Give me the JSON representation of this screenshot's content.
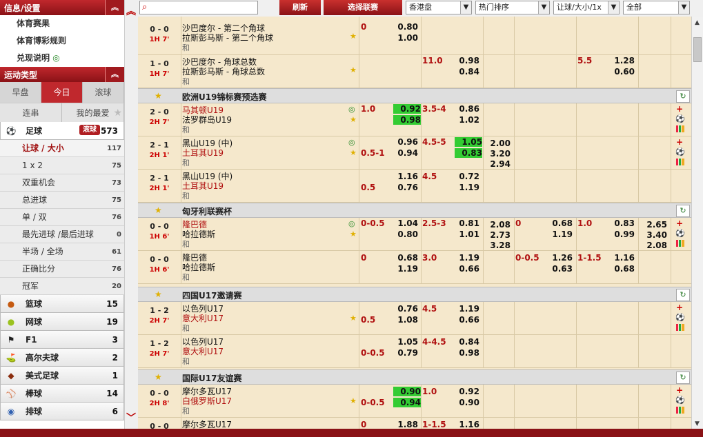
{
  "sidebar": {
    "info_title": "信息/设置",
    "info_items": [
      "体育赛果",
      "体育博彩规则",
      "兑现说明"
    ],
    "sport_type_title": "运动类型",
    "tabs": [
      "早盘",
      "今日",
      "滚球"
    ],
    "sub_tabs": [
      "连串",
      "我的最爱"
    ],
    "football": {
      "label": "足球",
      "badge": "滚球",
      "count": "573"
    },
    "bet_types": [
      {
        "label": "让球 / 大小",
        "count": "117"
      },
      {
        "label": "1 x 2",
        "count": "75"
      },
      {
        "label": "双重机会",
        "count": "73"
      },
      {
        "label": "总进球",
        "count": "75"
      },
      {
        "label": "单 / 双",
        "count": "76"
      },
      {
        "label": "最先进球 /最后进球",
        "count": "0"
      },
      {
        "label": "半场 / 全场",
        "count": "61"
      },
      {
        "label": "正确比分",
        "count": "76"
      },
      {
        "label": "冠军",
        "count": "20"
      }
    ],
    "sports": [
      {
        "label": "篮球",
        "count": "15"
      },
      {
        "label": "网球",
        "count": "19"
      },
      {
        "label": "F1",
        "count": "3"
      },
      {
        "label": "高尔夫球",
        "count": "2"
      },
      {
        "label": "美式足球",
        "count": "1"
      },
      {
        "label": "棒球",
        "count": "14"
      },
      {
        "label": "排球",
        "count": "6"
      }
    ]
  },
  "toolbar": {
    "refresh": "刷新",
    "select_league": "选择联赛",
    "odds_type": "香港盘",
    "sort": "热门排序",
    "market": "让球/大小/1x",
    "filter": "全部"
  },
  "leagues": [
    "欧洲U19锦标赛预选赛",
    "匈牙利联赛杯",
    "四国U17邀请赛",
    "国际U17友谊赛"
  ],
  "matches": [
    {
      "score": "0 - 0",
      "time": "1H 7'",
      "home": "沙巴度尔 - 第二个角球",
      "away": "拉斯彭马斯 - 第二个角球",
      "draw": "和",
      "o1": "0",
      "o2": "0.80",
      "o3": "1.00"
    },
    {
      "score": "1 - 0",
      "time": "1H 7'",
      "home": "沙巴度尔 - 角球总数",
      "away": "拉斯彭马斯 - 角球总数",
      "draw": "和",
      "hd1": "11.0",
      "v1": "0.98",
      "v2": "0.84",
      "hd2": "5.5",
      "v3": "1.28",
      "v4": "0.60"
    },
    {
      "score": "2 - 0",
      "time": "2H 7'",
      "home": "马其顿U19",
      "away": "法罗群岛U19",
      "draw": "和",
      "h": "1.0",
      "a": "0.92",
      "b": "0.98",
      "c": "3.5-4",
      "d": "0.86",
      "e": "1.02"
    },
    {
      "score": "2 - 1",
      "time": "2H 1'",
      "home": "黑山U19 (中)",
      "away": "土耳其U19",
      "draw": "和",
      "h": "0.5-1",
      "a": "0.96",
      "b": "0.94",
      "c": "4.5-5",
      "d": "1.05",
      "e": "0.83",
      "x1": "2.00",
      "x2": "3.20",
      "x3": "2.94"
    },
    {
      "score": "2 - 1",
      "time": "2H 1'",
      "home": "黑山U19 (中)",
      "away": "土耳其U19",
      "draw": "和",
      "h": "0.5",
      "a": "1.16",
      "b": "0.76",
      "c": "4.5",
      "d": "0.72",
      "e": "1.19"
    },
    {
      "score": "0 - 0",
      "time": "1H 6'",
      "home": "隆巴德",
      "away": "哈拉德斯",
      "draw": "和",
      "h": "0-0.5",
      "a": "1.04",
      "b": "0.80",
      "c": "2.5-3",
      "d": "0.81",
      "e": "1.01",
      "x1": "2.08",
      "x2": "2.73",
      "x3": "3.28",
      "h2": "0",
      "f": "0.68",
      "g": "1.19",
      "h3": "1.0",
      "i": "0.83",
      "j": "0.99",
      "y1": "2.65",
      "y2": "3.40",
      "y3": "2.08"
    },
    {
      "score": "0 - 0",
      "time": "1H 6'",
      "home": "隆巴德",
      "away": "哈拉德斯",
      "draw": "和",
      "h": "0",
      "a": "0.68",
      "b": "1.19",
      "c": "3.0",
      "d": "1.19",
      "e": "0.66",
      "h2": "0-0.5",
      "f": "1.26",
      "g": "0.63",
      "h3": "1-1.5",
      "i": "1.16",
      "j": "0.68"
    },
    {
      "score": "1 - 2",
      "time": "2H 7'",
      "home": "以色列U17",
      "away": "意大利U17",
      "draw": "和",
      "h": "0.5",
      "a": "0.76",
      "b": "1.08",
      "c": "4.5",
      "d": "1.19",
      "e": "0.66"
    },
    {
      "score": "1 - 2",
      "time": "2H 7'",
      "home": "以色列U17",
      "away": "意大利U17",
      "draw": "和",
      "h": "0-0.5",
      "a": "1.05",
      "b": "0.79",
      "c": "4-4.5",
      "d": "0.84",
      "e": "0.98"
    },
    {
      "score": "0 - 0",
      "time": "2H 8'",
      "home": "摩尔多瓦U17",
      "away": "白俄罗斯U17",
      "draw": "和",
      "h": "0-0.5",
      "a": "0.90",
      "b": "0.94",
      "c": "1.0",
      "d": "0.92",
      "e": "0.90"
    },
    {
      "score": "0 - 0",
      "time": "",
      "home": "摩尔多瓦U17",
      "away": "",
      "draw": "",
      "h": "0",
      "a": "1.88",
      "c": "1-1.5",
      "d": "1.16"
    }
  ],
  "colors": {
    "brand_red": "#c0282d",
    "highlight_green": "#33cc33",
    "row_bg": "#f5e8cc"
  }
}
